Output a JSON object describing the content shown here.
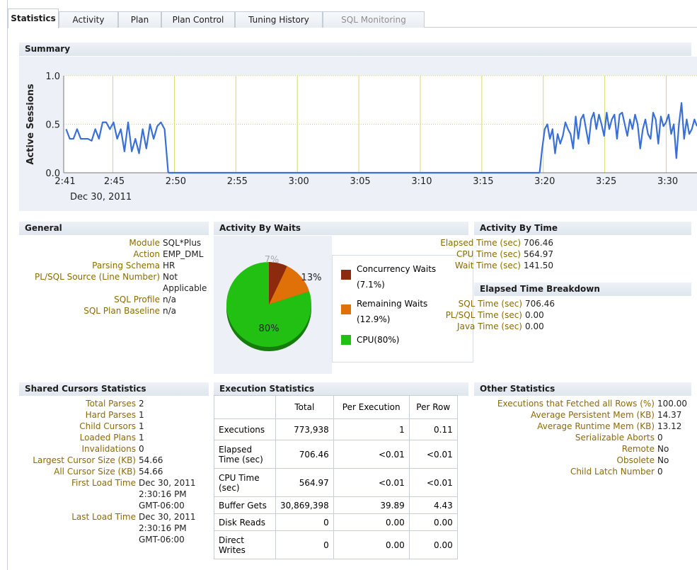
{
  "tabs": [
    {
      "label": "Statistics",
      "active": true
    },
    {
      "label": "Activity"
    },
    {
      "label": "Plan"
    },
    {
      "label": "Plan Control"
    },
    {
      "label": "Tuning History"
    },
    {
      "label": "SQL Monitoring",
      "disabled": true
    }
  ],
  "summary": {
    "title": "Summary",
    "ylabel": "Active Sessions",
    "date": "Dec 30, 2011"
  },
  "chart_data": {
    "type": "line",
    "ylabel": "Active Sessions",
    "ylim": [
      0,
      1.0
    ],
    "yticks": [
      "0.0",
      "0.5",
      "1.0"
    ],
    "xticks": [
      "2:41",
      "2:45",
      "2:50",
      "2:55",
      "3:00",
      "3:05",
      "3:10",
      "3:15",
      "3:20",
      "3:25",
      "3:30"
    ],
    "xticks_minutes": [
      0,
      4,
      9,
      14,
      19,
      24,
      29,
      34,
      39,
      44,
      49
    ],
    "xsub": "Dec 30, 2011",
    "grid": true,
    "color": "#3a6fd8",
    "segment1": [
      0.45,
      0.35,
      0.35,
      0.45,
      0.35,
      0.35,
      0.35,
      0.33,
      0.45,
      0.35,
      0.52,
      0.52,
      0.45,
      0.52,
      0.35,
      0.45,
      0.22,
      0.52,
      0.22,
      0.35,
      0.2,
      0.45,
      0.25,
      0.5,
      0.35,
      0.48,
      0.52,
      0.45,
      0.0
    ],
    "segment2": [
      0.0,
      0.25,
      0.45,
      0.5,
      0.35,
      0.45,
      0.2,
      0.4,
      0.3,
      0.38,
      0.52,
      0.45,
      0.4,
      0.25,
      0.58,
      0.35,
      0.55,
      0.6,
      0.45,
      0.3,
      0.55,
      0.62,
      0.45,
      0.6,
      0.5,
      0.38,
      0.62,
      0.45,
      0.55,
      0.6,
      0.35,
      0.6,
      0.62,
      0.5,
      0.38,
      0.55,
      0.45,
      0.6,
      0.5,
      0.25,
      0.45,
      0.55,
      0.4,
      0.35,
      0.62,
      0.55,
      0.3,
      0.58,
      0.48,
      0.52,
      0.6,
      0.4,
      0.5,
      0.15,
      0.5,
      0.72,
      0.35,
      0.55,
      0.4,
      0.45,
      0.55,
      0.48
    ]
  },
  "general": {
    "title": "General",
    "rows": [
      {
        "label": "Module",
        "value": "SQL*Plus"
      },
      {
        "label": "Action",
        "value": "EMP_DML"
      },
      {
        "label": "Parsing Schema",
        "value": "HR"
      },
      {
        "label": "PL/SQL Source (Line Number)",
        "value": "Not"
      },
      {
        "label": "",
        "value": "Applicable"
      },
      {
        "label": "SQL Profile",
        "value": "n/a"
      },
      {
        "label": "SQL Plan Baseline",
        "value": "n/a"
      }
    ]
  },
  "waits": {
    "title": "Activity By Waits",
    "slices": [
      {
        "name": "Concurrency Waits",
        "pct_label": "(7.1%)",
        "value": 7.1,
        "color": "#8b2a0c",
        "label": "7%"
      },
      {
        "name": "Remaining Waits",
        "pct_label": "(12.9%)",
        "value": 12.9,
        "color": "#e07008",
        "label": "13%"
      },
      {
        "name": "CPU(80%)",
        "value": 80,
        "color": "#22c012",
        "label": "80%"
      }
    ]
  },
  "by_time": {
    "title": "Activity By Time",
    "rows": [
      {
        "label": "Elapsed Time (sec)",
        "value": "706.46"
      },
      {
        "label": "CPU Time (sec)",
        "value": "564.97"
      },
      {
        "label": "Wait Time (sec)",
        "value": "141.50"
      }
    ]
  },
  "breakdown": {
    "title": "Elapsed Time Breakdown",
    "rows": [
      {
        "label": "SQL Time (sec)",
        "value": "706.46"
      },
      {
        "label": "PL/SQL Time (sec)",
        "value": "0.00"
      },
      {
        "label": "Java Time (sec)",
        "value": "0.00"
      }
    ]
  },
  "cursors": {
    "title": "Shared Cursors Statistics",
    "rows": [
      {
        "label": "Total Parses",
        "value": "2"
      },
      {
        "label": "Hard Parses",
        "value": "1"
      },
      {
        "label": "Child Cursors",
        "value": "1"
      },
      {
        "label": "Loaded Plans",
        "value": "1"
      },
      {
        "label": "Invalidations",
        "value": "0"
      },
      {
        "label": "Largest Cursor Size (KB)",
        "value": "54.66"
      },
      {
        "label": "All Cursor Size (KB)",
        "value": "54.66"
      },
      {
        "label": "First Load Time",
        "value": "Dec 30, 2011"
      },
      {
        "label": "",
        "value": "2:30:16 PM"
      },
      {
        "label": "",
        "value": "GMT-06:00"
      },
      {
        "label": "Last Load Time",
        "value": "Dec 30, 2011"
      },
      {
        "label": "",
        "value": "2:30:16 PM"
      },
      {
        "label": "",
        "value": "GMT-06:00"
      }
    ]
  },
  "exec": {
    "title": "Execution Statistics",
    "headers": [
      "",
      "Total",
      "Per Execution",
      "Per Row"
    ],
    "rows": [
      {
        "name": "Executions",
        "total": "773,938",
        "per_exec": "1",
        "per_row": "0.11"
      },
      {
        "name": "Elapsed Time (sec)",
        "total": "706.46",
        "per_exec": "<0.01",
        "per_row": "<0.01"
      },
      {
        "name": "CPU Time (sec)",
        "total": "564.97",
        "per_exec": "<0.01",
        "per_row": "<0.01"
      },
      {
        "name": "Buffer Gets",
        "total": "30,869,398",
        "per_exec": "39.89",
        "per_row": "4.43"
      },
      {
        "name": "Disk Reads",
        "total": "0",
        "per_exec": "0.00",
        "per_row": "0.00"
      },
      {
        "name": "Direct Writes",
        "total": "0",
        "per_exec": "0.00",
        "per_row": "0.00"
      }
    ]
  },
  "other": {
    "title": "Other Statistics",
    "rows": [
      {
        "label": "Executions that Fetched all Rows (%)",
        "value": "100.00"
      },
      {
        "label": "Average Persistent Mem (KB)",
        "value": "14.37"
      },
      {
        "label": "Average Runtime Mem (KB)",
        "value": "13.12"
      },
      {
        "label": "Serializable Aborts",
        "value": "0"
      },
      {
        "label": "Remote",
        "value": "No"
      },
      {
        "label": "Obsolete",
        "value": "No"
      },
      {
        "label": "Child Latch Number",
        "value": "0"
      }
    ]
  }
}
